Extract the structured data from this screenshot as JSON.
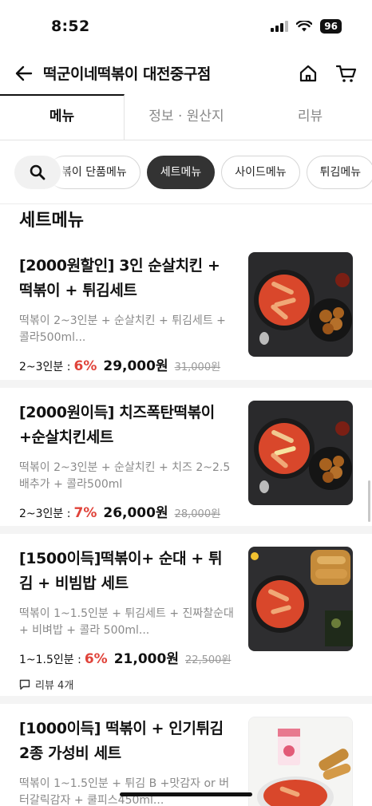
{
  "status": {
    "time": "8:52",
    "battery": "96"
  },
  "header": {
    "title": "떡군이네떡볶이 대전중구점"
  },
  "tabs": [
    {
      "label": "메뉴"
    },
    {
      "label": "정보 · 원산지"
    },
    {
      "label": "리뷰"
    }
  ],
  "categories": [
    {
      "label": "볶이 단품메뉴"
    },
    {
      "label": "세트메뉴"
    },
    {
      "label": "사이드메뉴"
    },
    {
      "label": "튀김메뉴"
    }
  ],
  "section": {
    "title": "세트메뉴"
  },
  "items": [
    {
      "name": "[2000원할인] 3인 순살치킨 + 떡볶이 + 튀김세트",
      "desc": "떡볶이 2~3인분 + 순살치킨 + 튀김세트 + 콜라500ml...",
      "serving": "2~3인분 :",
      "discount": "6%",
      "price": "29,000원",
      "original": "31,000원"
    },
    {
      "name": "[2000원이득] 치즈폭탄떡볶이 +순살치킨세트",
      "desc": "떡볶이 2~3인분 + 순살치킨 + 치즈 2~2.5 배추가 + 콜라500ml",
      "serving": "2~3인분 :",
      "discount": "7%",
      "price": "26,000원",
      "original": "28,000원"
    },
    {
      "name": "[1500이득]떡볶이+ 순대 + 튀김 + 비빔밥 세트",
      "desc": "떡볶이 1~1.5인분 + 튀김세트 + 진짜찰순대 + 비벼밥 + 콜라 500ml...",
      "serving": "1~1.5인분 :",
      "discount": "6%",
      "price": "21,000원",
      "original": "22,500원",
      "review": "리뷰 4개"
    },
    {
      "name": "[1000이득] 떡볶이 + 인기튀김 2종 가성비 세트",
      "desc": "떡볶이 1~1.5인분 + 튀김 B +맛감자 or 버터갈릭감자 + 쿨피스450ml..."
    }
  ]
}
